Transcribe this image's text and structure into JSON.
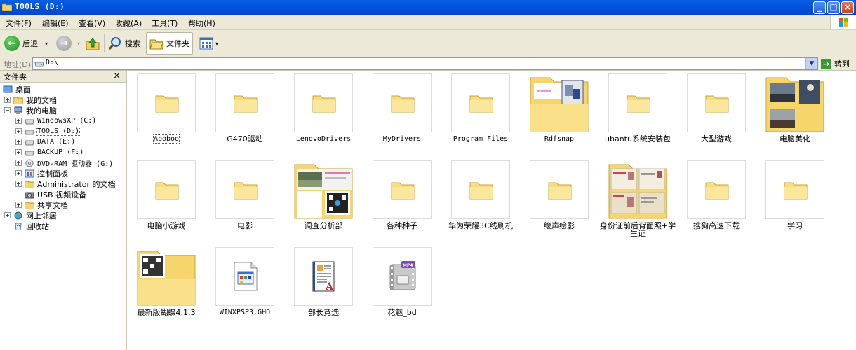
{
  "window": {
    "title": "TOOLS (D:)",
    "buttons": [
      "_",
      "□",
      "×"
    ]
  },
  "menu": {
    "items": [
      "文件(F)",
      "编辑(E)",
      "查看(V)",
      "收藏(A)",
      "工具(T)",
      "帮助(H)"
    ]
  },
  "toolbar": {
    "back_label": "后退",
    "search_label": "搜索",
    "folders_label": "文件夹"
  },
  "address": {
    "label": "地址(D)",
    "value": "D:\\",
    "go_label": "转到"
  },
  "sidebar": {
    "title": "文件夹",
    "close": "×",
    "tree": [
      {
        "label": "桌面",
        "icon": "desktop-icon"
      },
      {
        "label": "我的文档",
        "icon": "folder-icon"
      },
      {
        "label": "我的电脑",
        "icon": "computer-icon"
      },
      {
        "label": "WindowsXP (C:)",
        "icon": "drive-icon"
      },
      {
        "label": "TOOLS (D:)",
        "icon": "drive-icon"
      },
      {
        "label": "DATA (E:)",
        "icon": "drive-icon"
      },
      {
        "label": "BACKUP (F:)",
        "icon": "drive-icon"
      },
      {
        "label": "DVD-RAM 驱动器 (G:)",
        "icon": "dvd-icon"
      },
      {
        "label": "控制面板",
        "icon": "control-panel-icon"
      },
      {
        "label": "Administrator 的文档",
        "icon": "folder-icon"
      },
      {
        "label": "USB 视频设备",
        "icon": "camera-icon"
      },
      {
        "label": "共享文档",
        "icon": "folder-icon"
      },
      {
        "label": "网上邻居",
        "icon": "network-icon"
      },
      {
        "label": "回收站",
        "icon": "recycle-bin-icon"
      }
    ]
  },
  "items": [
    {
      "label": "Aboboo",
      "kind": "folder"
    },
    {
      "label": "G470驱动",
      "kind": "folder"
    },
    {
      "label": "LenovoDrivers",
      "kind": "folder"
    },
    {
      "label": "MyDrivers",
      "kind": "folder"
    },
    {
      "label": "Program Files",
      "kind": "folder"
    },
    {
      "label": "Rdfsnap",
      "kind": "preview-folder"
    },
    {
      "label": "ubantu系统安装包",
      "kind": "folder"
    },
    {
      "label": "大型游戏",
      "kind": "folder"
    },
    {
      "label": "电脑美化",
      "kind": "preview-folder"
    },
    {
      "label": "电脑小游戏",
      "kind": "folder"
    },
    {
      "label": "电影",
      "kind": "folder"
    },
    {
      "label": "调查分析部",
      "kind": "preview-folder"
    },
    {
      "label": "各种种子",
      "kind": "folder"
    },
    {
      "label": "华为荣耀3C线刷机",
      "kind": "folder"
    },
    {
      "label": "绘声绘影",
      "kind": "folder"
    },
    {
      "label": "身份证前后背面照+学生证",
      "kind": "preview-folder"
    },
    {
      "label": "搜狗高速下载",
      "kind": "folder"
    },
    {
      "label": "学习",
      "kind": "folder"
    },
    {
      "label": "最新版蝴蝶4.1.3",
      "kind": "preview-folder"
    },
    {
      "label": "WINXPSP3.GHO",
      "kind": "file"
    },
    {
      "label": "部长竞选",
      "kind": "file"
    },
    {
      "label": "花魅_bd",
      "kind": "file"
    }
  ]
}
